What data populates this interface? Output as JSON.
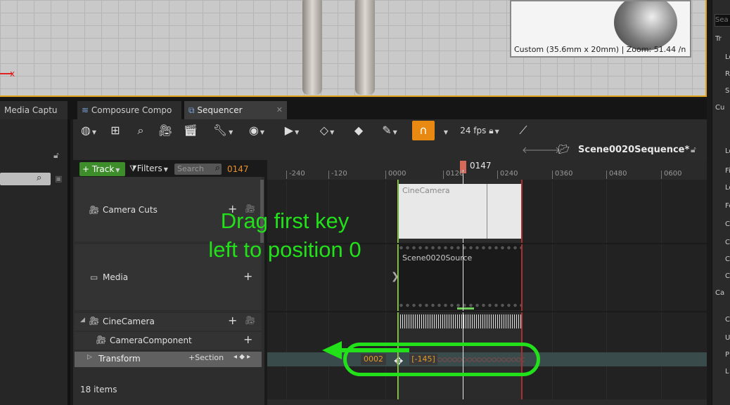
{
  "viewport": {
    "axis_label": "x",
    "preview_caption": "Custom (35.6mm x 20mm) | Zoom: 51.44 /n"
  },
  "right_panel": {
    "search_placeholder": "Sea",
    "items": [
      "Tr",
      "Lo",
      "Ro",
      "Sc",
      "Cu",
      "Lo",
      "Fi",
      "Lo",
      "Fo",
      "C",
      "C",
      "C",
      "C",
      "Ca",
      "C",
      "U",
      "P",
      "L"
    ]
  },
  "tabs": [
    {
      "label": "Media Captu",
      "active": false
    },
    {
      "label": "Composure Compo",
      "active": false
    },
    {
      "label": "Sequencer",
      "active": true
    }
  ],
  "toolbar": {
    "fps": "24 fps"
  },
  "bar2": {
    "sequence_name": "Scene0020Sequence*"
  },
  "tracks_toolbar": {
    "track_label": "Track",
    "filters_label": "Filters",
    "search_placeholder": "Search",
    "current_frame": "0147"
  },
  "tracks": {
    "camera_cuts": "Camera Cuts",
    "media": "Media",
    "cine_camera": "CineCamera",
    "camera_component": "CameraComponent",
    "transform": "Transform",
    "transform_section": "Section",
    "item_count": "18 items"
  },
  "timeline": {
    "ticks": [
      "-240",
      "-120",
      "0000",
      "0120",
      "0240",
      "0360",
      "0480",
      "0600"
    ],
    "playhead_label": "0147",
    "cine_camera_clip": "CineCamera",
    "media_clip": "Scene0020Source",
    "key_frame_label": "0002",
    "key_offset_label": "[-145]"
  },
  "annotation": {
    "line1": "Drag first key",
    "line2": "left to position 0",
    "color": "#22e01a"
  }
}
